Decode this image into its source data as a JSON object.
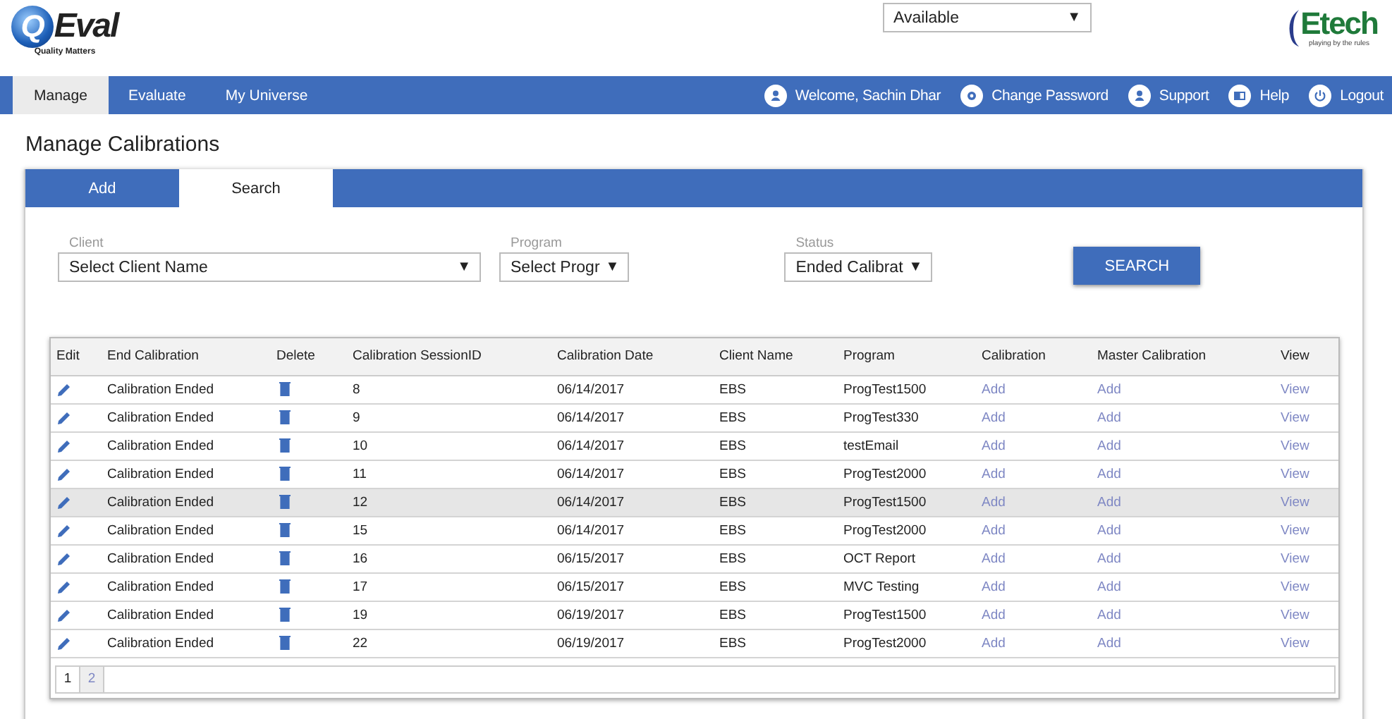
{
  "header": {
    "logo": {
      "letter": "Q",
      "name": "Eval",
      "tagline": "Quality Matters"
    },
    "availability": {
      "value": "Available",
      "arrow": "▼"
    },
    "partner_logo": {
      "name": "Etech",
      "tagline": "playing by the rules"
    }
  },
  "nav": {
    "items": [
      {
        "label": "Manage",
        "selected": true
      },
      {
        "label": "Evaluate",
        "selected": false
      },
      {
        "label": "My Universe",
        "selected": false
      }
    ],
    "user_links": [
      {
        "kind": "user",
        "label": "Welcome, Sachin Dhar"
      },
      {
        "kind": "settings",
        "label": "Change Password"
      },
      {
        "kind": "support",
        "label": "Support"
      },
      {
        "kind": "help",
        "label": "Help"
      },
      {
        "kind": "logout",
        "label": "Logout"
      }
    ]
  },
  "page_title": "Manage Calibrations",
  "panel": {
    "tabs": [
      {
        "label": "Add",
        "selected": false
      },
      {
        "label": "Search",
        "selected": true
      }
    ],
    "filters": [
      {
        "label": "Client",
        "value": "Select Client Name",
        "arrow": "▼",
        "kind": "wide"
      },
      {
        "label": "Program",
        "value": "Select Progr",
        "arrow": "▼",
        "kind": "narrow"
      },
      {
        "label": "Status",
        "value": "Ended Calibrat",
        "arrow": "▼",
        "kind": "narrow"
      }
    ],
    "search_button": "SEARCH",
    "table": {
      "columns": [
        "Edit",
        "End Calibration",
        "Delete",
        "Calibration SessionID",
        "Calibration Date",
        "Client Name",
        "Program",
        "Calibration",
        "Master Calibration",
        "View"
      ],
      "rows": [
        {
          "end_calibration": "Calibration Ended",
          "session_id": "8",
          "date": "06/14/2017",
          "client": "EBS",
          "program": "ProgTest1500",
          "calibration": "Add",
          "master_calibration": "Add",
          "view": "View",
          "highlighted": false
        },
        {
          "end_calibration": "Calibration Ended",
          "session_id": "9",
          "date": "06/14/2017",
          "client": "EBS",
          "program": "ProgTest330",
          "calibration": "Add",
          "master_calibration": "Add",
          "view": "View",
          "highlighted": false
        },
        {
          "end_calibration": "Calibration Ended",
          "session_id": "10",
          "date": "06/14/2017",
          "client": "EBS",
          "program": "testEmail",
          "calibration": "Add",
          "master_calibration": "Add",
          "view": "View",
          "highlighted": false
        },
        {
          "end_calibration": "Calibration Ended",
          "session_id": "11",
          "date": "06/14/2017",
          "client": "EBS",
          "program": "ProgTest2000",
          "calibration": "Add",
          "master_calibration": "Add",
          "view": "View",
          "highlighted": false
        },
        {
          "end_calibration": "Calibration Ended",
          "session_id": "12",
          "date": "06/14/2017",
          "client": "EBS",
          "program": "ProgTest1500",
          "calibration": "Add",
          "master_calibration": "Add",
          "view": "View",
          "highlighted": true
        },
        {
          "end_calibration": "Calibration Ended",
          "session_id": "15",
          "date": "06/14/2017",
          "client": "EBS",
          "program": "ProgTest2000",
          "calibration": "Add",
          "master_calibration": "Add",
          "view": "View",
          "highlighted": false
        },
        {
          "end_calibration": "Calibration Ended",
          "session_id": "16",
          "date": "06/15/2017",
          "client": "EBS",
          "program": "OCT Report",
          "calibration": "Add",
          "master_calibration": "Add",
          "view": "View",
          "highlighted": false
        },
        {
          "end_calibration": "Calibration Ended",
          "session_id": "17",
          "date": "06/15/2017",
          "client": "EBS",
          "program": "MVC Testing",
          "calibration": "Add",
          "master_calibration": "Add",
          "view": "View",
          "highlighted": false
        },
        {
          "end_calibration": "Calibration Ended",
          "session_id": "19",
          "date": "06/19/2017",
          "client": "EBS",
          "program": "ProgTest1500",
          "calibration": "Add",
          "master_calibration": "Add",
          "view": "View",
          "highlighted": false
        },
        {
          "end_calibration": "Calibration Ended",
          "session_id": "22",
          "date": "06/19/2017",
          "client": "EBS",
          "program": "ProgTest2000",
          "calibration": "Add",
          "master_calibration": "Add",
          "view": "View",
          "highlighted": false
        }
      ],
      "pages": [
        {
          "label": "1",
          "selected": true
        },
        {
          "label": "2",
          "selected": false
        }
      ]
    }
  }
}
